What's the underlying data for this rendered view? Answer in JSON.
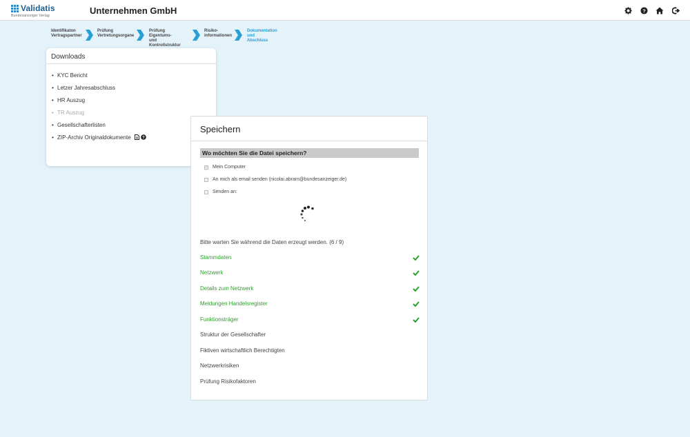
{
  "header": {
    "logo_text": "Validatis",
    "logo_subtext": "Bundesanzeiger Verlag",
    "company": "Unternehmen GmbH",
    "icons": [
      "gear-icon",
      "help-icon",
      "home-icon",
      "logout-icon"
    ]
  },
  "steps": [
    {
      "line1": "Identifikaton",
      "line2": "Vertragspartner",
      "active": false
    },
    {
      "line1": "Prüfung",
      "line2": "Vertretungsorgane",
      "active": false
    },
    {
      "line1": "Prüfung Eigentums-",
      "line2": "und Kontrollstruktur",
      "active": false
    },
    {
      "line1": "Risiko-",
      "line2": "informationen",
      "active": false
    },
    {
      "line1": "Dokumentation und",
      "line2": "Abschluss",
      "active": true
    }
  ],
  "downloads": {
    "title": "Downloads",
    "items": [
      {
        "label": "KYC Bericht",
        "disabled": false
      },
      {
        "label": "Letzer Jahresabschluss",
        "disabled": false
      },
      {
        "label": "HR Auszug",
        "disabled": false
      },
      {
        "label": "TR Auszug",
        "disabled": true
      },
      {
        "label": "Gesellschafterlisten",
        "disabled": false
      },
      {
        "label": "ZIP-Archiv Originaldokumente",
        "disabled": false
      }
    ]
  },
  "modal": {
    "title": "Speichern",
    "question": "Wo möchten Sie die Datei speichern?",
    "options": [
      {
        "label": "Mein Computer",
        "checked": true
      },
      {
        "label": "An mich als email senden (nicolai.abram@bundesanzeiger.de)",
        "checked": false
      },
      {
        "label": "Senden an:",
        "checked": false
      }
    ],
    "wait_text": "Bitte warten Sie während die Daten erzeugt werden. (6 / 9)",
    "tasks": [
      {
        "label": "Stammdaten",
        "done": true
      },
      {
        "label": "Netzwerk",
        "done": true
      },
      {
        "label": "Details zum Netzwerk",
        "done": true
      },
      {
        "label": "Meldungen Handelsregister",
        "done": true
      },
      {
        "label": "Funktionsträger",
        "done": true
      },
      {
        "label": "Struktur der Gesellschafter",
        "done": false
      },
      {
        "label": "Fiktiven wirtschaftlich Berechtigten",
        "done": false
      },
      {
        "label": "Netzwerkrisiken",
        "done": false
      },
      {
        "label": "Prüfung Risikofaktoren",
        "done": false
      }
    ]
  },
  "colors": {
    "accent": "#2a9fd6",
    "done": "#2ca02c",
    "background": "#e4f2fa"
  }
}
